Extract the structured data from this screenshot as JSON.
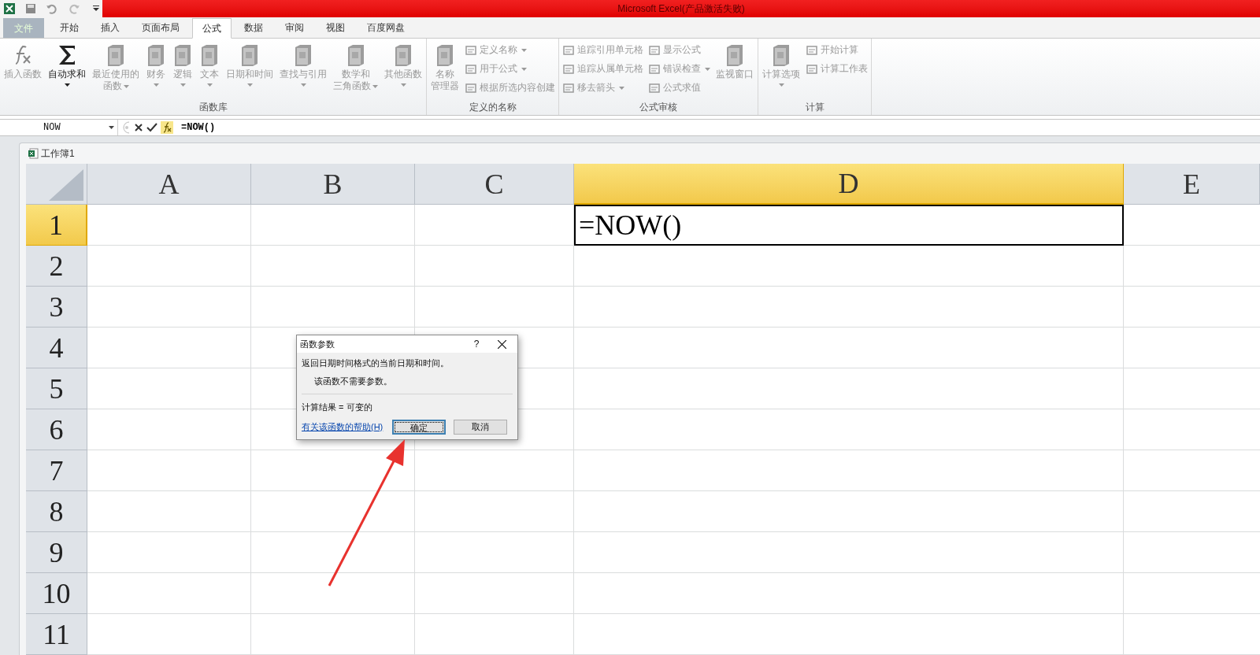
{
  "title_bar": {
    "title": "Microsoft Excel(产品激活失败)"
  },
  "tabs": [
    {
      "label": "文件",
      "kind": "file",
      "selected": false
    },
    {
      "label": "开始",
      "kind": "tab",
      "selected": false
    },
    {
      "label": "插入",
      "kind": "tab",
      "selected": false
    },
    {
      "label": "页面布局",
      "kind": "tab",
      "selected": false
    },
    {
      "label": "公式",
      "kind": "tab",
      "selected": true
    },
    {
      "label": "数据",
      "kind": "tab",
      "selected": false
    },
    {
      "label": "审阅",
      "kind": "tab",
      "selected": false
    },
    {
      "label": "视图",
      "kind": "tab",
      "selected": false
    },
    {
      "label": "百度网盘",
      "kind": "tab",
      "selected": false
    }
  ],
  "ribbon": {
    "groups": [
      {
        "label": "函数库",
        "columns": [
          [
            {
              "kind": "large",
              "lines": [
                "插入函数"
              ],
              "disabled": true,
              "dropdown": false
            }
          ],
          [
            {
              "kind": "large",
              "lines": [
                "自动求和"
              ],
              "disabled": false,
              "dropdown": true
            }
          ],
          [
            {
              "kind": "large",
              "lines": [
                "最近使用的",
                "函数"
              ],
              "disabled": true,
              "dropdown": true
            }
          ],
          [
            {
              "kind": "large",
              "lines": [
                "财务"
              ],
              "disabled": true,
              "dropdown": true
            }
          ],
          [
            {
              "kind": "large",
              "lines": [
                "逻辑"
              ],
              "disabled": true,
              "dropdown": true
            }
          ],
          [
            {
              "kind": "large",
              "lines": [
                "文本"
              ],
              "disabled": true,
              "dropdown": true
            }
          ],
          [
            {
              "kind": "large",
              "lines": [
                "日期和时间"
              ],
              "disabled": true,
              "dropdown": true
            }
          ],
          [
            {
              "kind": "large",
              "lines": [
                "查找与引用"
              ],
              "disabled": true,
              "dropdown": true
            }
          ],
          [
            {
              "kind": "large",
              "lines": [
                "数学和",
                "三角函数"
              ],
              "disabled": true,
              "dropdown": true
            }
          ],
          [
            {
              "kind": "large",
              "lines": [
                "其他函数"
              ],
              "disabled": true,
              "dropdown": true
            }
          ]
        ]
      },
      {
        "label": "定义的名称",
        "columns": [
          [
            {
              "kind": "large",
              "lines": [
                "名称",
                "管理器"
              ],
              "disabled": true,
              "dropdown": false
            }
          ],
          [
            {
              "kind": "small",
              "lines": [
                "定义名称"
              ],
              "disabled": true,
              "dropdown": true
            },
            {
              "kind": "small",
              "lines": [
                "用于公式"
              ],
              "disabled": true,
              "dropdown": true
            },
            {
              "kind": "small",
              "lines": [
                "根据所选内容创建"
              ],
              "disabled": true,
              "dropdown": false
            }
          ]
        ]
      },
      {
        "label": "公式审核",
        "columns": [
          [
            {
              "kind": "small",
              "lines": [
                "追踪引用单元格"
              ],
              "disabled": true,
              "dropdown": false
            },
            {
              "kind": "small",
              "lines": [
                "追踪从属单元格"
              ],
              "disabled": true,
              "dropdown": false
            },
            {
              "kind": "small",
              "lines": [
                "移去箭头"
              ],
              "disabled": true,
              "dropdown": true
            }
          ],
          [
            {
              "kind": "small",
              "lines": [
                "显示公式"
              ],
              "disabled": true,
              "dropdown": false
            },
            {
              "kind": "small",
              "lines": [
                "错误检查"
              ],
              "disabled": true,
              "dropdown": true
            },
            {
              "kind": "small",
              "lines": [
                "公式求值"
              ],
              "disabled": true,
              "dropdown": false
            }
          ],
          [
            {
              "kind": "large",
              "lines": [
                "监视窗口"
              ],
              "disabled": true,
              "dropdown": false
            }
          ]
        ]
      },
      {
        "label": "计算",
        "columns": [
          [
            {
              "kind": "large",
              "lines": [
                "计算选项"
              ],
              "disabled": true,
              "dropdown": true
            }
          ],
          [
            {
              "kind": "small",
              "lines": [
                "开始计算"
              ],
              "disabled": true,
              "dropdown": false
            },
            {
              "kind": "small",
              "lines": [
                "计算工作表"
              ],
              "disabled": true,
              "dropdown": false
            }
          ]
        ]
      }
    ]
  },
  "formula_bar": {
    "name_box": "NOW",
    "formula": "=NOW()"
  },
  "workbook": {
    "title": "工作簿1"
  },
  "sheet": {
    "columns": [
      {
        "label": "A",
        "selected": false
      },
      {
        "label": "B",
        "selected": false
      },
      {
        "label": "C",
        "selected": false
      },
      {
        "label": "D",
        "selected": true
      },
      {
        "label": "E",
        "selected": false
      }
    ],
    "rows": [
      {
        "label": "1",
        "selected": true,
        "cells": [
          "",
          "",
          "",
          "=NOW()",
          ""
        ]
      },
      {
        "label": "2",
        "selected": false
      },
      {
        "label": "3",
        "selected": false
      },
      {
        "label": "4",
        "selected": false
      },
      {
        "label": "5",
        "selected": false
      },
      {
        "label": "6",
        "selected": false
      },
      {
        "label": "7",
        "selected": false
      },
      {
        "label": "8",
        "selected": false
      },
      {
        "label": "9",
        "selected": false
      },
      {
        "label": "10",
        "selected": false
      },
      {
        "label": "11",
        "selected": false
      }
    ]
  },
  "dialog": {
    "title": "函数参数",
    "help": "?",
    "description": "返回日期时间格式的当前日期和时间。",
    "note": "该函数不需要参数。",
    "result": "计算结果 = 可变的",
    "help_link": "有关该函数的帮助(H)",
    "buttons": [
      {
        "label": "确定",
        "focused": true
      },
      {
        "label": "取消",
        "focused": false
      }
    ]
  }
}
